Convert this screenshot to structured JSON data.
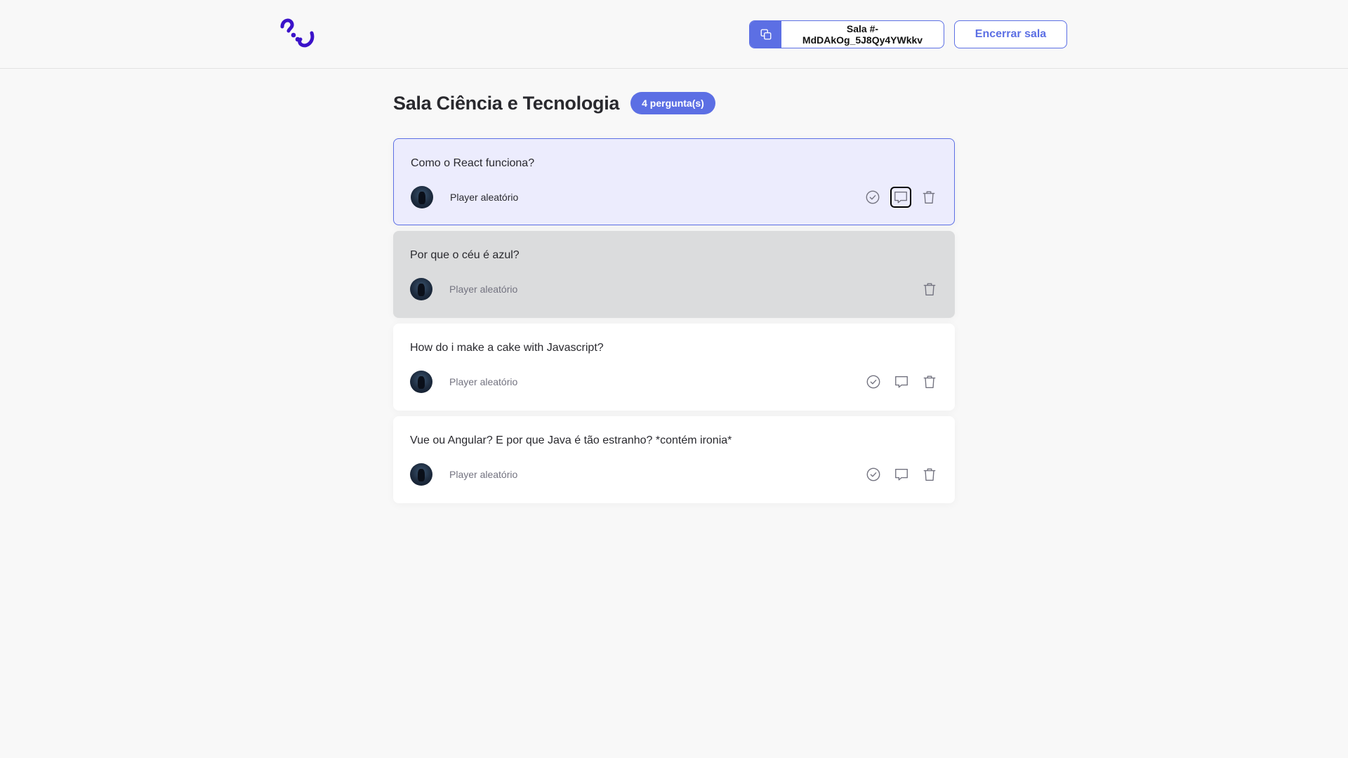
{
  "header": {
    "logo_icon": "question-logo-icon",
    "room_code_label": "Sala #-MdDAkOg_5J8Qy4YWkkv",
    "copy_icon": "copy-icon",
    "close_room_label": "Encerrar sala"
  },
  "main": {
    "title": "Sala Ciência e Tecnologia",
    "badge": "4 pergunta(s)"
  },
  "questions": [
    {
      "text": "Como o React funciona?",
      "author": "Player aleatório",
      "state": "highlighted"
    },
    {
      "text": "Por que o céu é azul?",
      "author": "Player aleatório",
      "state": "answered"
    },
    {
      "text": "How do i make a cake with Javascript?",
      "author": "Player aleatório",
      "state": "default"
    },
    {
      "text": "Vue ou Angular? E por que Java é tão estranho? *contém ironia*",
      "author": "Player aleatório",
      "state": "default"
    }
  ],
  "colors": {
    "accent": "#5c6fe4",
    "logo": "#3b12c9",
    "highlight_bg": "#ececfd",
    "answered_bg": "#dbdcdd"
  }
}
